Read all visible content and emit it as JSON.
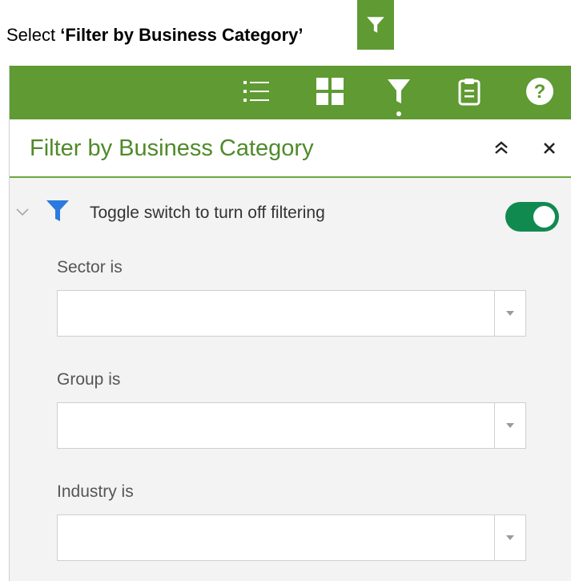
{
  "instruction": {
    "prefix": "Select ",
    "target": "‘Filter by Business Category’"
  },
  "toolbar": {
    "icons": [
      "list-icon",
      "grid-icon",
      "filter-icon",
      "clipboard-icon",
      "help-icon"
    ],
    "active": "filter-icon"
  },
  "panel": {
    "title": "Filter by Business Category",
    "collapse_icon": "double-chevron-up-icon",
    "close_icon": "close-icon"
  },
  "filter": {
    "label": "Toggle switch to turn off filtering",
    "enabled": true,
    "fields": [
      {
        "label": "Sector is",
        "value": ""
      },
      {
        "label": "Group is",
        "value": ""
      },
      {
        "label": "Industry is",
        "value": ""
      }
    ]
  },
  "colors": {
    "toolbar_green": "#5f9a33",
    "title_green": "#4f8a2a",
    "toggle_on": "#118a50",
    "filter_icon_blue": "#2c7ae0"
  }
}
